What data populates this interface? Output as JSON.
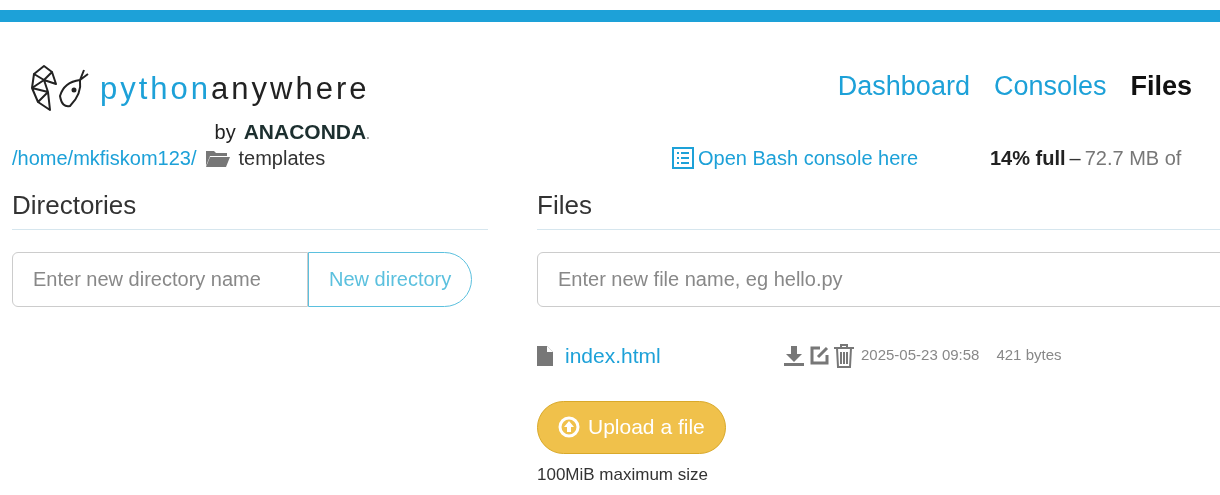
{
  "logo": {
    "word_a": "python",
    "word_b": "anywhere",
    "by": "by",
    "brand": "ANACONDA",
    "brand_dot": "."
  },
  "nav": [
    {
      "label": "Dashboard",
      "selected": false
    },
    {
      "label": "Consoles",
      "selected": false
    },
    {
      "label": "Files",
      "selected": true
    }
  ],
  "breadcrumb": {
    "path": "/home/mkfiskom123/",
    "folder": "templates"
  },
  "bash_link": "Open Bash console here",
  "usage": {
    "percent": "14% full",
    "dash": "–",
    "rest": "72.7 MB of"
  },
  "directories": {
    "title": "Directories",
    "placeholder": "Enter new directory name",
    "button": "New directory"
  },
  "files": {
    "title": "Files",
    "placeholder": "Enter new file name, eg hello.py",
    "items": [
      {
        "name": "index.html",
        "date": "2025-05-23 09:58",
        "size": "421 bytes"
      }
    ],
    "upload_button": "Upload a file",
    "upload_note": "100MiB maximum size"
  }
}
